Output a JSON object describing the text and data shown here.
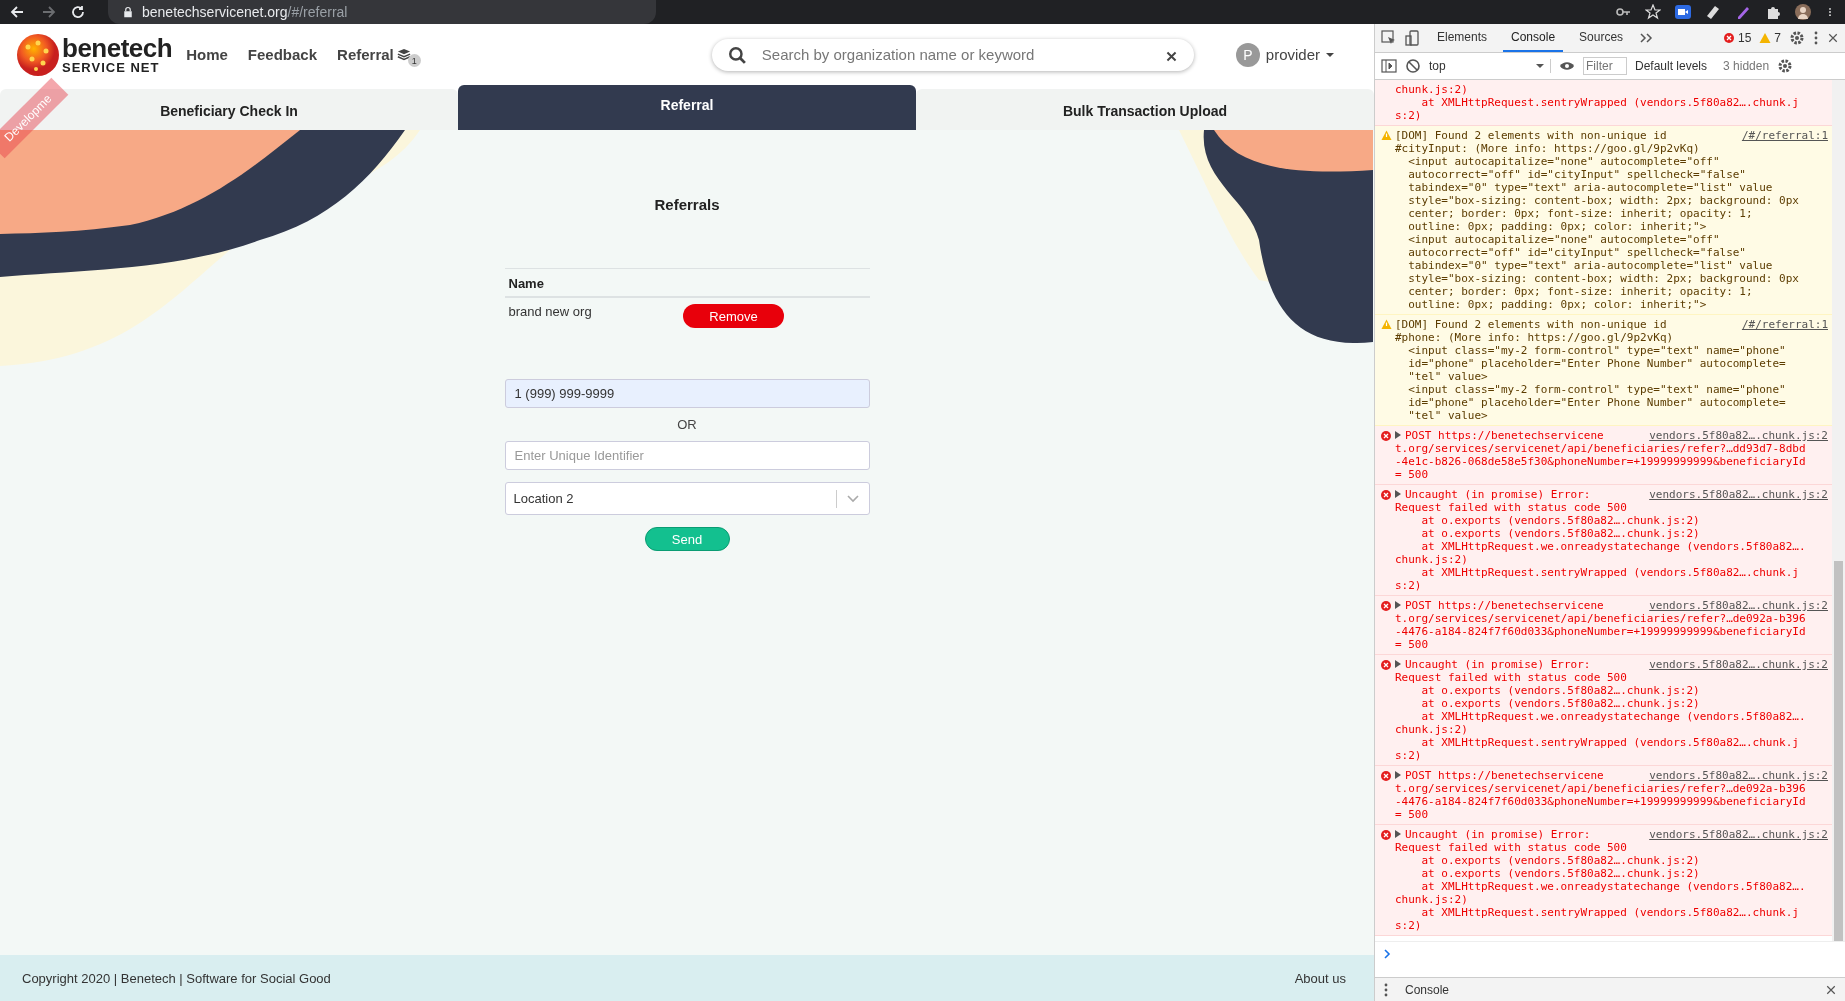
{
  "browser": {
    "url_host": "benetechservicenet.org",
    "url_path": "/#/referral"
  },
  "ribbon": {
    "label": "Developme"
  },
  "header": {
    "brand": "benetech",
    "brand_sub": "SERVICE NET",
    "nav": [
      {
        "label": "Home"
      },
      {
        "label": "Feedback"
      },
      {
        "label": "Referral",
        "badge": "1"
      }
    ],
    "search": {
      "placeholder": "Search by organization name or keyword"
    },
    "user": {
      "initial": "P",
      "name": "provider"
    }
  },
  "tabs": [
    {
      "label": "Beneficiary Check In",
      "selected": false
    },
    {
      "label": "Referral",
      "selected": true
    },
    {
      "label": "Bulk Transaction Upload",
      "selected": false
    }
  ],
  "referrals": {
    "title": "Referrals",
    "columns": [
      "Name"
    ],
    "rows": [
      {
        "name": "brand new org",
        "action": "Remove"
      }
    ],
    "phone": {
      "value": "1 (999) 999-9999",
      "autofilled": true
    },
    "separator": "OR",
    "identifier": {
      "placeholder": "Enter Unique Identifier"
    },
    "location": {
      "value": "Location 2"
    },
    "submit": "Send"
  },
  "footer": {
    "copyright": "Copyright 2020 | Benetech | Software for Social Good",
    "link": "About us"
  },
  "devtools": {
    "tabs": [
      {
        "label": "Elements",
        "selected": false
      },
      {
        "label": "Console",
        "selected": true
      },
      {
        "label": "Sources",
        "selected": false
      }
    ],
    "errors": "15",
    "warnings": "7",
    "context": "top",
    "filter_placeholder": "Filter",
    "levels": "Default levels",
    "hidden": "3 hidden",
    "messages": [
      {
        "kind": "error",
        "continued": true,
        "expandable": false,
        "lines": [
          "chunk.js:2)",
          "    at XMLHttpRequest.sentryWrapped (vendors.5f80a82….chunk.j",
          "s:2)"
        ]
      },
      {
        "kind": "warning",
        "continued": false,
        "expandable": false,
        "source": "/#/referral:1",
        "lines": [
          "[DOM] Found 2 elements with non-unique id",
          "#cityInput: (More info: https://goo.gl/9p2vKq)",
          "  <input autocapitalize=\"none\" autocomplete=\"off\"",
          "  autocorrect=\"off\" id=\"cityInput\" spellcheck=\"false\"",
          "  tabindex=\"0\" type=\"text\" aria-autocomplete=\"list\" value",
          "  style=\"box-sizing: content-box; width: 2px; background: 0px",
          "  center; border: 0px; font-size: inherit; opacity: 1;",
          "  outline: 0px; padding: 0px; color: inherit;\">",
          "  <input autocapitalize=\"none\" autocomplete=\"off\"",
          "  autocorrect=\"off\" id=\"cityInput\" spellcheck=\"false\"",
          "  tabindex=\"0\" type=\"text\" aria-autocomplete=\"list\" value",
          "  style=\"box-sizing: content-box; width: 2px; background: 0px",
          "  center; border: 0px; font-size: inherit; opacity: 1;",
          "  outline: 0px; padding: 0px; color: inherit;\">"
        ]
      },
      {
        "kind": "warning",
        "continued": false,
        "expandable": false,
        "source": "/#/referral:1",
        "lines": [
          "[DOM] Found 2 elements with non-unique id",
          "#phone: (More info: https://goo.gl/9p2vKq)",
          "  <input class=\"my-2 form-control\" type=\"text\" name=\"phone\"",
          "  id=\"phone\" placeholder=\"Enter Phone Number\" autocomplete=",
          "  \"tel\" value>",
          "  <input class=\"my-2 form-control\" type=\"text\" name=\"phone\"",
          "  id=\"phone\" placeholder=\"Enter Phone Number\" autocomplete=",
          "  \"tel\" value>"
        ]
      },
      {
        "kind": "error",
        "continued": false,
        "expandable": true,
        "source": "vendors.5f80a82….chunk.js:2",
        "lines": [
          "POST https://benetechservicene",
          "t.org/services/servicenet/api/beneficiaries/refer?…dd93d7-8dbd",
          "-4e1c-b826-068de58e5f30&phoneNumber=+19999999999&beneficiaryId",
          "= 500"
        ]
      },
      {
        "kind": "error",
        "continued": false,
        "expandable": true,
        "source": "vendors.5f80a82….chunk.js:2",
        "lines": [
          "Uncaught (in promise) Error:",
          "Request failed with status code 500",
          "    at o.exports (vendors.5f80a82….chunk.js:2)",
          "    at o.exports (vendors.5f80a82….chunk.js:2)",
          "    at XMLHttpRequest.we.onreadystatechange (vendors.5f80a82….",
          "chunk.js:2)",
          "    at XMLHttpRequest.sentryWrapped (vendors.5f80a82….chunk.j",
          "s:2)"
        ]
      },
      {
        "kind": "error",
        "continued": false,
        "expandable": true,
        "source": "vendors.5f80a82….chunk.js:2",
        "lines": [
          "POST https://benetechservicene",
          "t.org/services/servicenet/api/beneficiaries/refer?…de092a-b396",
          "-4476-a184-824f7f60d033&phoneNumber=+19999999999&beneficiaryId",
          "= 500"
        ]
      },
      {
        "kind": "error",
        "continued": false,
        "expandable": true,
        "source": "vendors.5f80a82….chunk.js:2",
        "lines": [
          "Uncaught (in promise) Error:",
          "Request failed with status code 500",
          "    at o.exports (vendors.5f80a82….chunk.js:2)",
          "    at o.exports (vendors.5f80a82….chunk.js:2)",
          "    at XMLHttpRequest.we.onreadystatechange (vendors.5f80a82….",
          "chunk.js:2)",
          "    at XMLHttpRequest.sentryWrapped (vendors.5f80a82….chunk.j",
          "s:2)"
        ]
      },
      {
        "kind": "error",
        "continued": false,
        "expandable": true,
        "source": "vendors.5f80a82….chunk.js:2",
        "lines": [
          "POST https://benetechservicene",
          "t.org/services/servicenet/api/beneficiaries/refer?…de092a-b396",
          "-4476-a184-824f7f60d033&phoneNumber=+19999999999&beneficiaryId",
          "= 500"
        ]
      },
      {
        "kind": "error",
        "continued": false,
        "expandable": true,
        "source": "vendors.5f80a82….chunk.js:2",
        "lines": [
          "Uncaught (in promise) Error:",
          "Request failed with status code 500",
          "    at o.exports (vendors.5f80a82….chunk.js:2)",
          "    at o.exports (vendors.5f80a82….chunk.js:2)",
          "    at XMLHttpRequest.we.onreadystatechange (vendors.5f80a82….",
          "chunk.js:2)",
          "    at XMLHttpRequest.sentryWrapped (vendors.5f80a82….chunk.j",
          "s:2)"
        ]
      }
    ],
    "drawer": "Console"
  }
}
